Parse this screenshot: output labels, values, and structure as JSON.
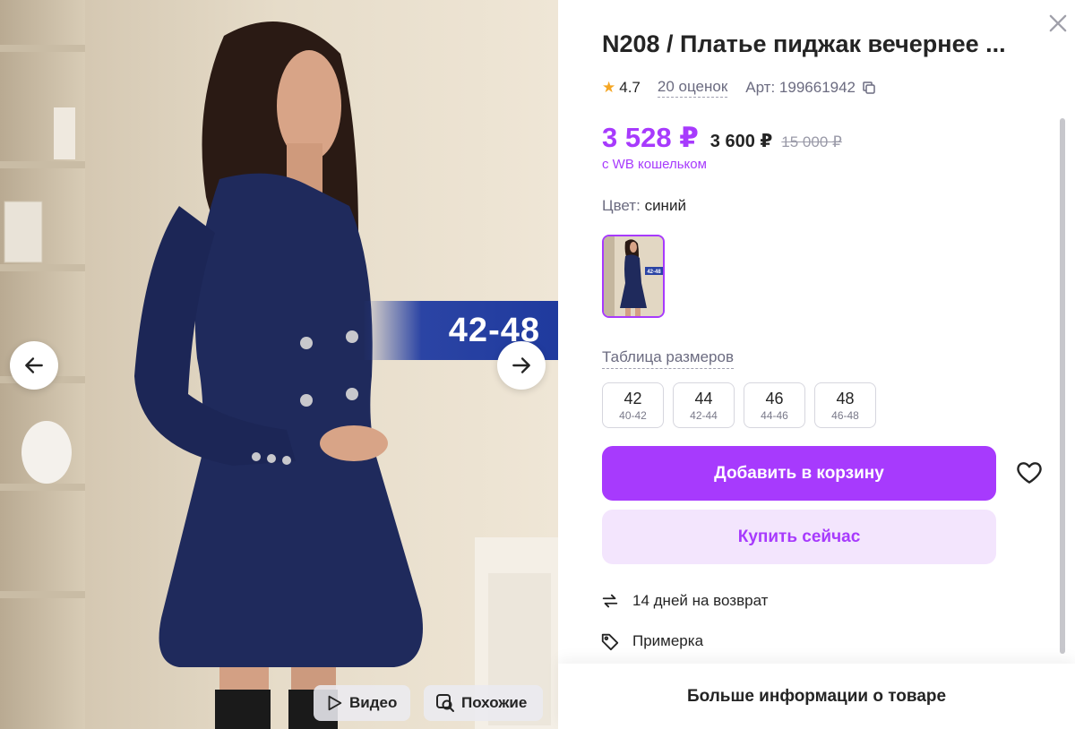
{
  "gallery": {
    "size_banner": "42-48",
    "prev_icon": "arrow-left-icon",
    "next_icon": "arrow-right-icon",
    "video_label": "Видео",
    "similar_label": "Похожие"
  },
  "product": {
    "title": "N208 / Платье пиджак вечернее ...",
    "rating": "4.7",
    "reviews": "20 оценок",
    "article": "Арт: 199661942",
    "price_wallet": "3 528 ₽",
    "price_regular": "3 600 ₽",
    "price_old": "15 000 ₽",
    "wallet_note": "с WB кошельком",
    "color_key": "Цвет:",
    "color_value": "синий",
    "color_thumb_badge": "42-48",
    "size_table_label": "Таблица размеров",
    "sizes": [
      {
        "size": "42",
        "range": "40-42"
      },
      {
        "size": "44",
        "range": "42-44"
      },
      {
        "size": "46",
        "range": "44-46"
      },
      {
        "size": "48",
        "range": "46-48"
      }
    ],
    "add_to_cart": "Добавить в корзину",
    "buy_now": "Купить сейчас",
    "features": [
      {
        "icon": "return-arrows-icon",
        "label": "14 дней на возврат"
      },
      {
        "icon": "tag-icon",
        "label": "Примерка"
      }
    ],
    "more_info": "Больше информации о товаре"
  },
  "colors": {
    "accent": "#a73afd",
    "accent_light": "#f3e5fd",
    "dress": "#1f2a5c",
    "banner": "#2b44a4",
    "star": "#f5a623"
  }
}
